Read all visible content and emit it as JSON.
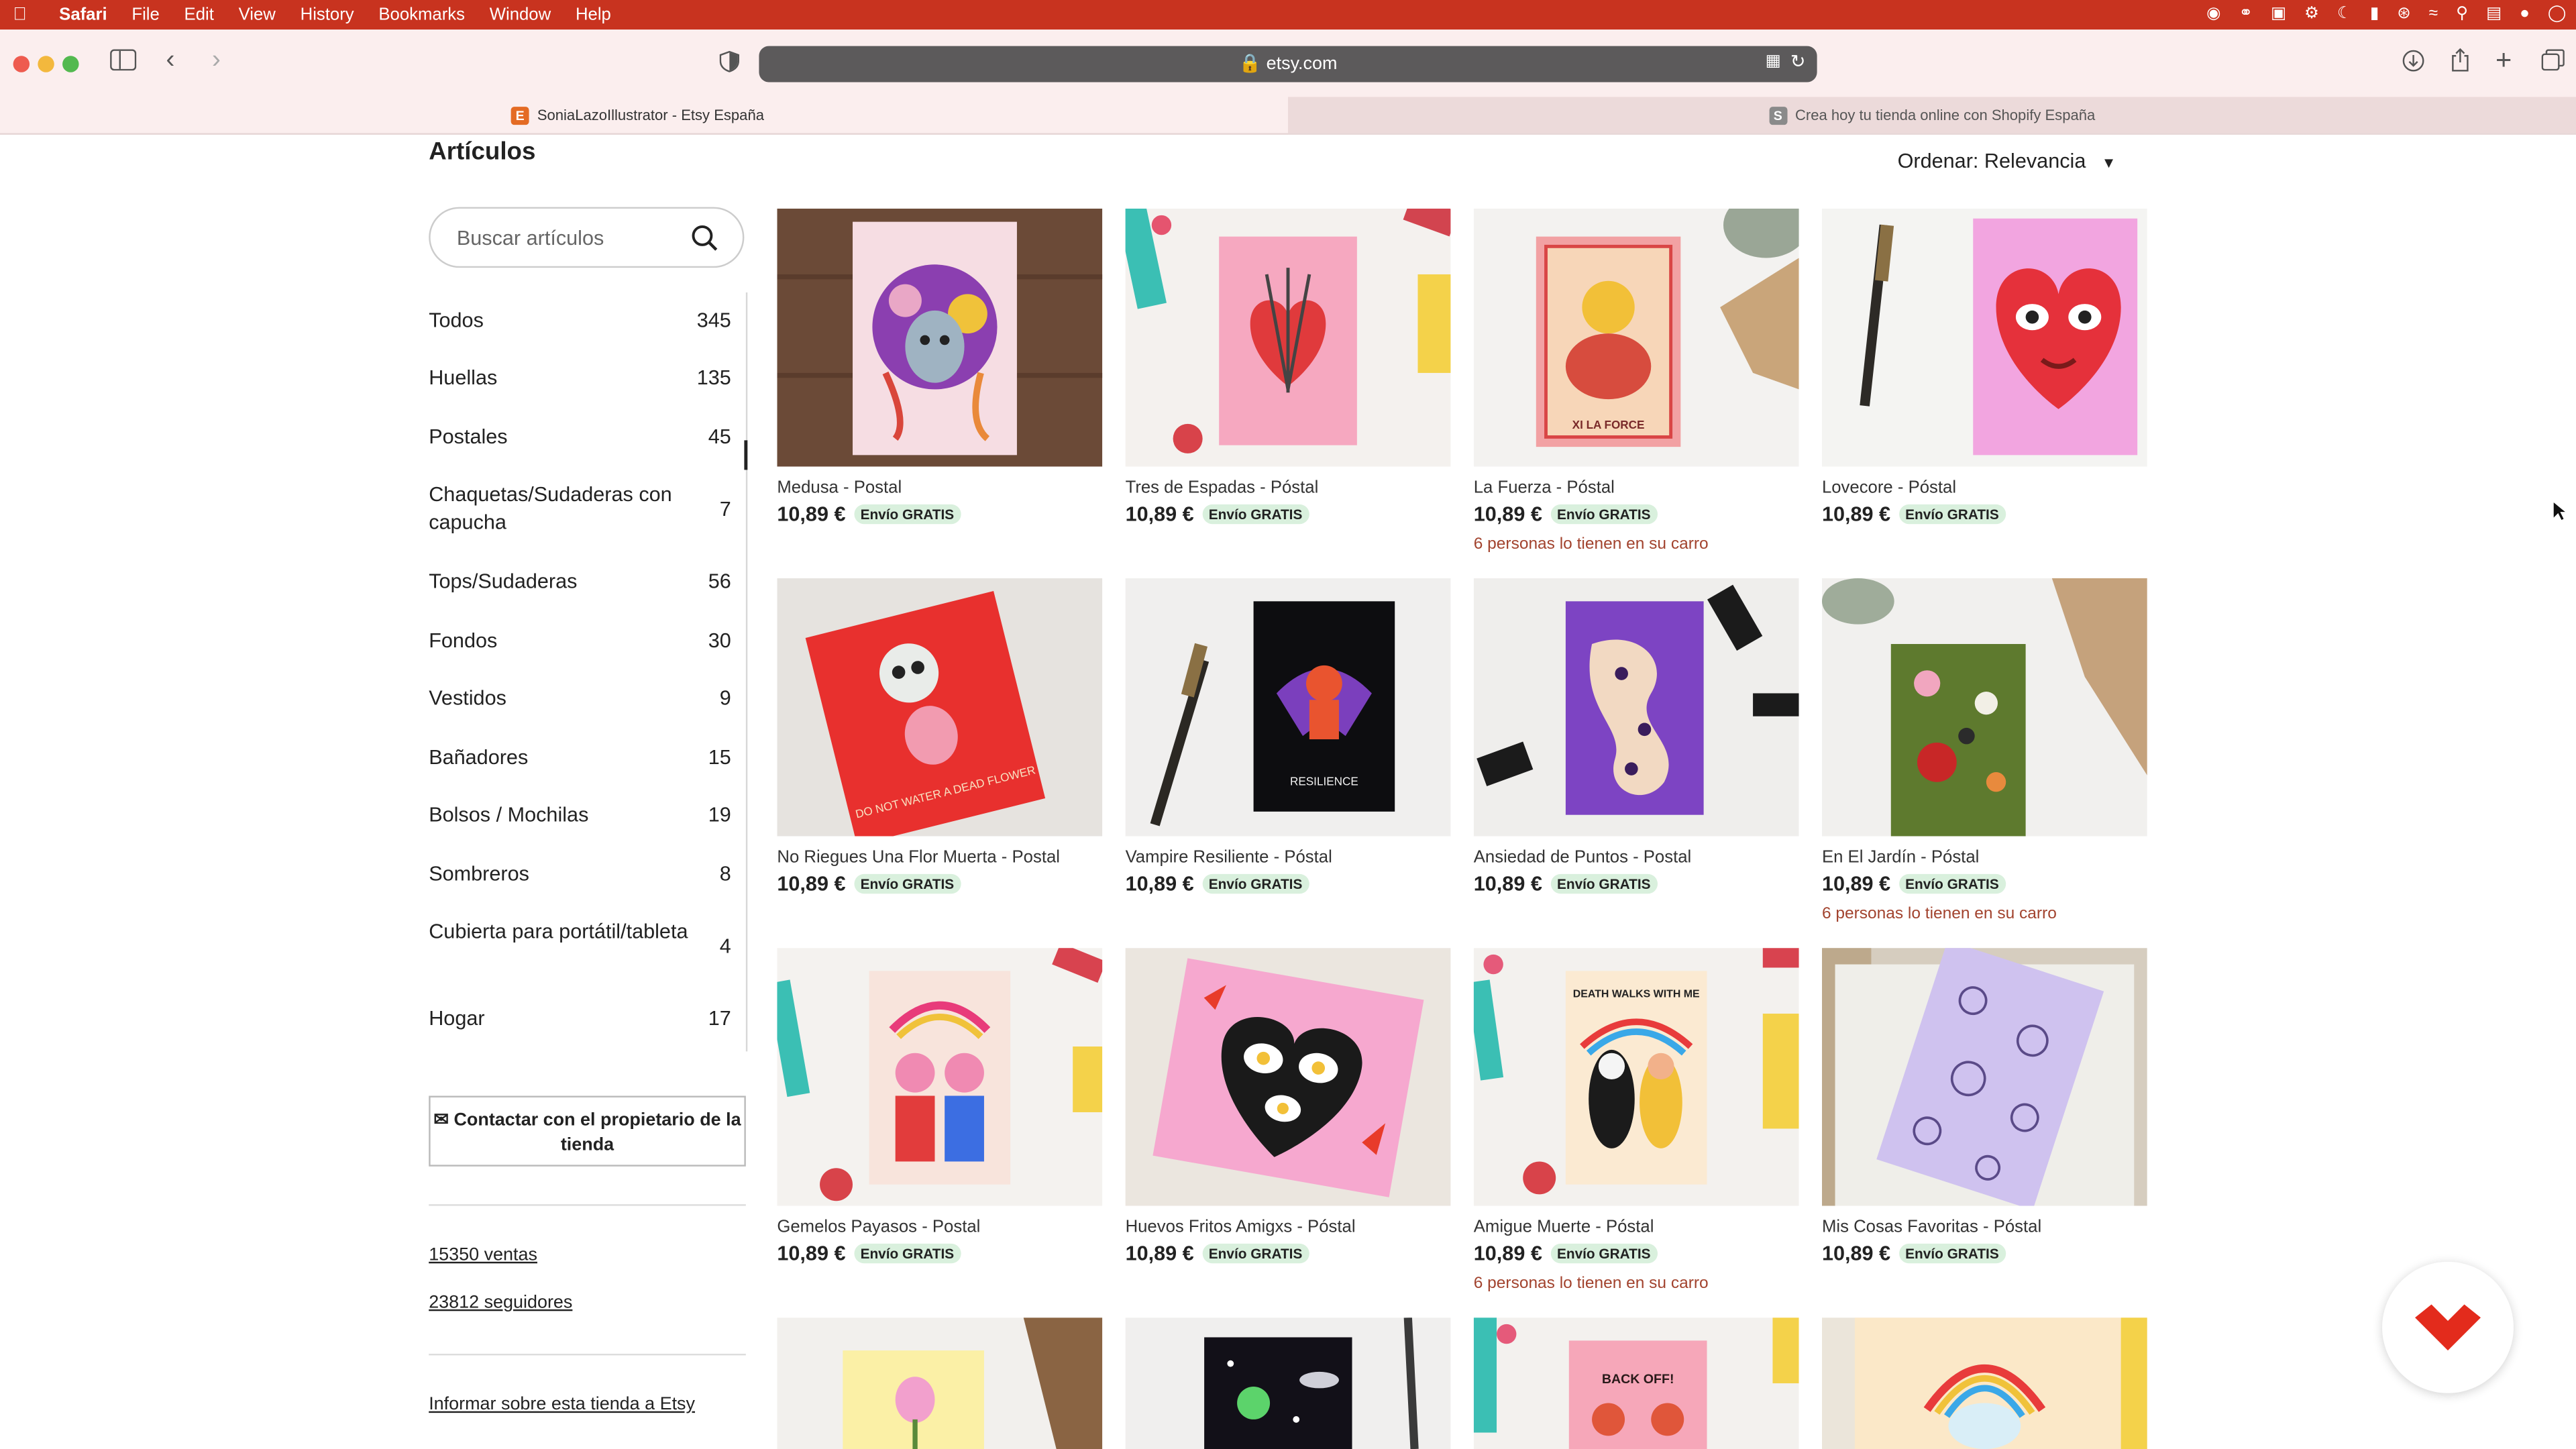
{
  "menubar": {
    "app": "Safari",
    "items": [
      "File",
      "Edit",
      "View",
      "History",
      "Bookmarks",
      "Window",
      "Help"
    ]
  },
  "browser": {
    "url": "etsy.com",
    "tabs": [
      {
        "title": "SoniaLazoIllustrator - Etsy España",
        "favicon": "E",
        "active": true
      },
      {
        "title": "Crea hoy tu tienda online con Shopify España",
        "favicon": "S",
        "active": false
      }
    ]
  },
  "shop": {
    "section_title": "Artículos",
    "sort_label": "Ordenar: Relevancia",
    "search_placeholder": "Buscar artículos",
    "categories": [
      {
        "label": "Todos",
        "count": "345"
      },
      {
        "label": "Huellas",
        "count": "135"
      },
      {
        "label": "Postales",
        "count": "45"
      },
      {
        "label": "Chaquetas/Sudaderas con capucha",
        "count": "7"
      },
      {
        "label": "Tops/Sudaderas",
        "count": "56"
      },
      {
        "label": "Fondos",
        "count": "30"
      },
      {
        "label": "Vestidos",
        "count": "9"
      },
      {
        "label": "Bañadores",
        "count": "15"
      },
      {
        "label": "Bolsos / Mochilas",
        "count": "19"
      },
      {
        "label": "Sombreros",
        "count": "8"
      },
      {
        "label": "Cubierta para portátil/tableta",
        "count": "4"
      },
      {
        "label": "Hogar",
        "count": "17"
      }
    ],
    "contact_label": "Contactar con el propietario de la tienda",
    "sales": "15350 ventas",
    "followers": "23812 seguidores",
    "report": "Informar sobre esta tienda a Etsy"
  },
  "products": [
    {
      "name": "Medusa - Postal",
      "price": "10,89 €",
      "badge": "Envío GRATIS",
      "cart_note": ""
    },
    {
      "name": "Tres de Espadas - Póstal",
      "price": "10,89 €",
      "badge": "Envío GRATIS",
      "cart_note": ""
    },
    {
      "name": "La Fuerza - Póstal",
      "price": "10,89 €",
      "badge": "Envío GRATIS",
      "cart_note": "6 personas lo tienen en su carro"
    },
    {
      "name": "Lovecore - Póstal",
      "price": "10,89 €",
      "badge": "Envío GRATIS",
      "cart_note": ""
    },
    {
      "name": "No Riegues Una Flor Muerta - Postal",
      "price": "10,89 €",
      "badge": "Envío GRATIS",
      "cart_note": ""
    },
    {
      "name": "Vampire Resiliente - Póstal",
      "price": "10,89 €",
      "badge": "Envío GRATIS",
      "cart_note": ""
    },
    {
      "name": "Ansiedad de Puntos - Postal",
      "price": "10,89 €",
      "badge": "Envío GRATIS",
      "cart_note": ""
    },
    {
      "name": "En El Jardín - Póstal",
      "price": "10,89 €",
      "badge": "Envío GRATIS",
      "cart_note": "6 personas lo tienen en su carro"
    },
    {
      "name": "Gemelos Payasos - Postal",
      "price": "10,89 €",
      "badge": "Envío GRATIS",
      "cart_note": ""
    },
    {
      "name": "Huevos Fritos Amigxs - Póstal",
      "price": "10,89 €",
      "badge": "Envío GRATIS",
      "cart_note": ""
    },
    {
      "name": "Amigue Muerte - Póstal",
      "price": "10,89 €",
      "badge": "Envío GRATIS",
      "cart_note": "6 personas lo tienen en su carro"
    },
    {
      "name": "Mis Cosas Favoritas - Póstal",
      "price": "10,89 €",
      "badge": "Envío GRATIS",
      "cart_note": ""
    }
  ],
  "postcard_texts": {
    "la_fuerza": "XI LA FORCE",
    "no_riegues": "DO NOT WATER A DEAD FLOWER",
    "vampire": "RESILIENCE",
    "amigue": "DEATH WALKS WITH ME",
    "row4_card3": "BACK OFF!"
  },
  "colors": {
    "menubar": "#c8331f",
    "toolbar": "#fbeeee",
    "free_badge": "#d9f0dd",
    "cart_note": "#a2432e"
  }
}
